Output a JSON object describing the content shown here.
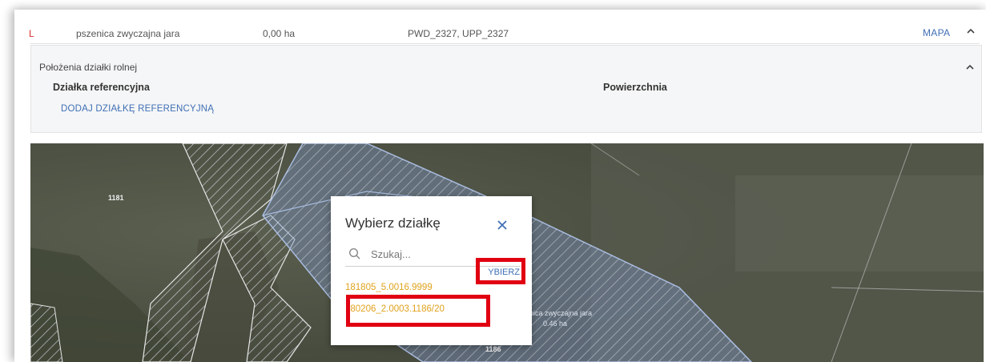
{
  "crop_row": {
    "code": "L",
    "name": "pszenica zwyczajna jara",
    "area": "0,00 ha",
    "packages": "PWD_2327, UPP_2327",
    "map_button": "MAPA",
    "collapse_icon": "chevron-up-icon"
  },
  "positions_panel": {
    "title": "Położenia działki rolnej",
    "column_parcel": "Działka referencyjna",
    "column_area": "Powierzchnia",
    "add_link": "DODAJ DZIAŁKĘ REFERENCYJNĄ",
    "collapse_icon": "chevron-up-icon"
  },
  "map": {
    "labels": {
      "parcel_left": "1181",
      "crop_label_name": "pszenica zwyczajna jara",
      "crop_label_area": "0.46 ha",
      "parcel_bottom": "1186"
    }
  },
  "dialog": {
    "title": "Wybierz działkę",
    "close_icon": "close-icon",
    "search_placeholder": "Szukaj...",
    "search_value": "",
    "select_button": "YBIERZ",
    "items": [
      "181805_5.0016.9999",
      "180206_2.0003.1186/20"
    ]
  },
  "colors": {
    "accent_blue": "#3f6fb5",
    "item_orange": "#e0a21d",
    "code_red": "#d32f2f",
    "annotation_red": "#e00012"
  }
}
